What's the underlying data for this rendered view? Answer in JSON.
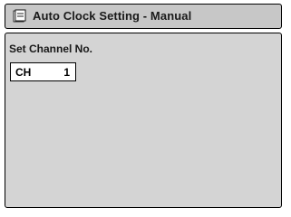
{
  "screen": {
    "title": "Auto Clock Setting - Manual",
    "title_icon": "clock-setting-icon"
  },
  "main": {
    "section_label": "Set Channel No.",
    "channel": {
      "label": "CH",
      "value": "1"
    }
  }
}
